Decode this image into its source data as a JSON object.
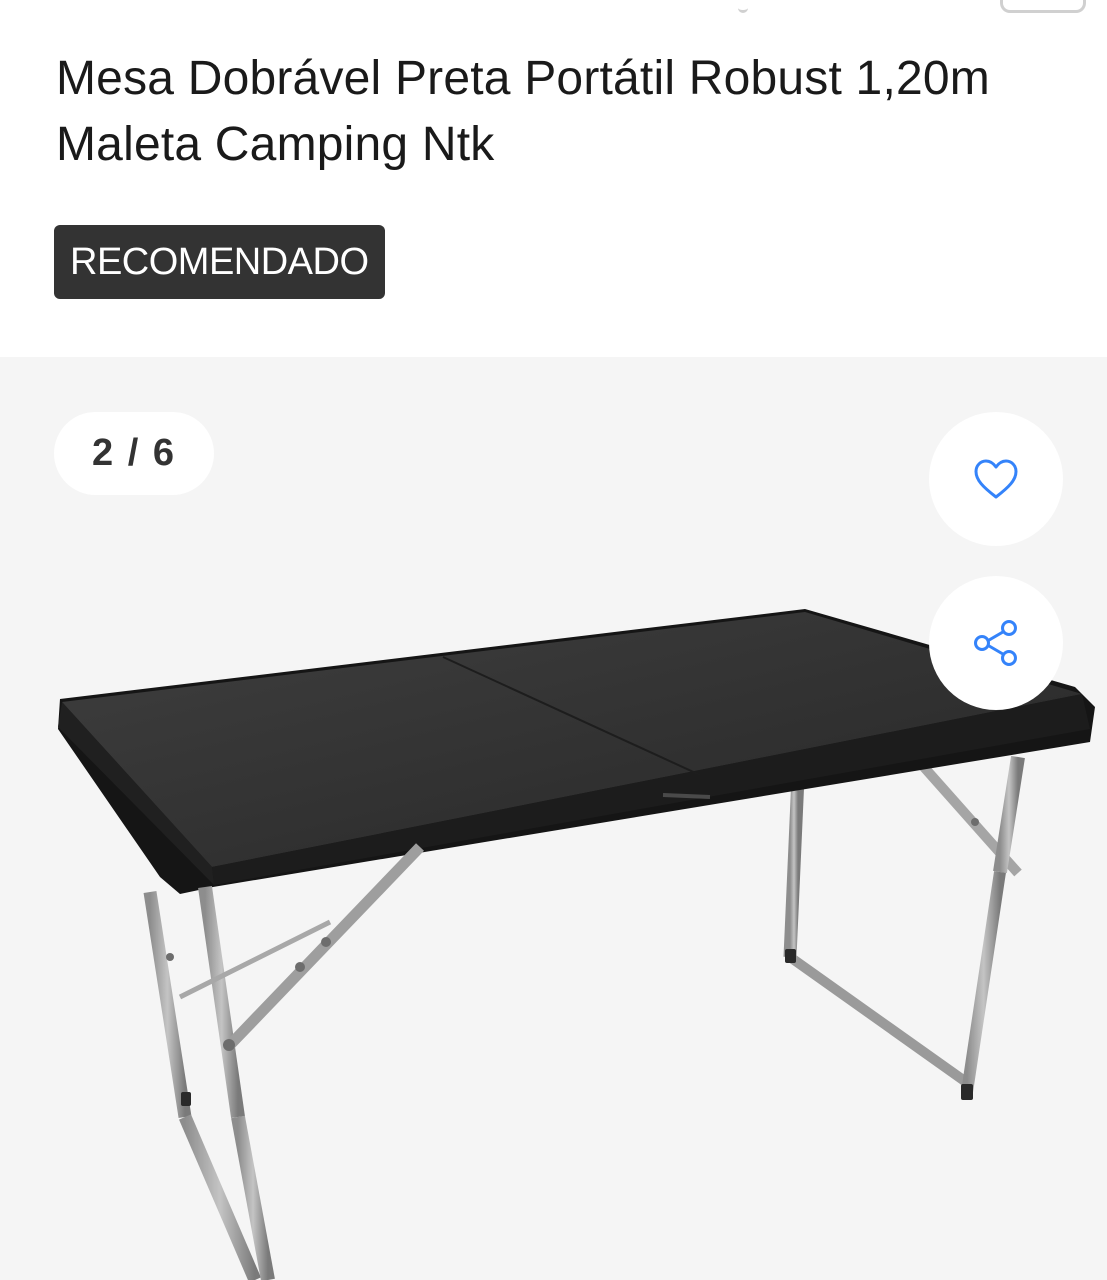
{
  "product": {
    "title": "Mesa Dobrável Preta Portátil Robust 1,20m Maleta Camping Ntk",
    "badge": "RECOMENDADO"
  },
  "gallery": {
    "counter": "2 / 6",
    "current_image": 2,
    "total_images": 6,
    "image_subject": "black folding table with grey metal legs"
  },
  "actions": {
    "favorite_icon": "heart-icon",
    "share_icon": "share-icon"
  },
  "colors": {
    "accent": "#3483fa",
    "badge_background": "#333333",
    "gallery_background": "#f5f5f5",
    "title_text": "#1a1a1a"
  }
}
